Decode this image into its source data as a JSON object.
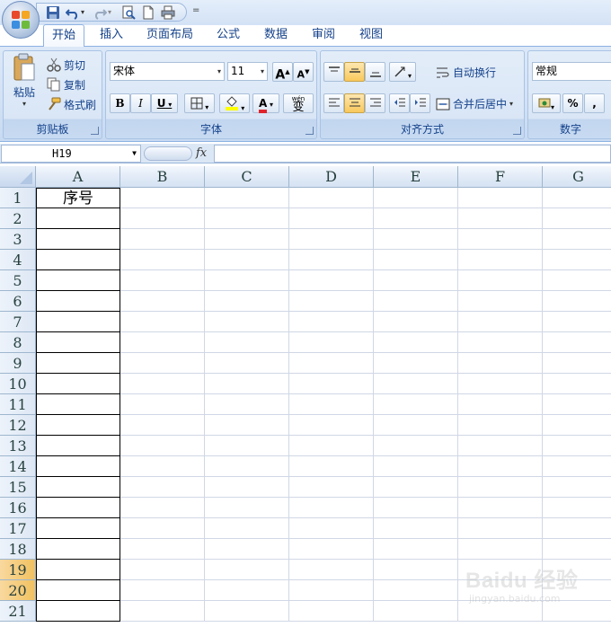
{
  "qat": {
    "icons": [
      "save-icon",
      "undo-icon",
      "redo-icon",
      "print-preview-icon",
      "new-icon",
      "print-icon"
    ],
    "more": "="
  },
  "tabs": [
    "开始",
    "插入",
    "页面布局",
    "公式",
    "数据",
    "审阅",
    "视图"
  ],
  "active_tab": "开始",
  "clipboard": {
    "paste": "粘贴",
    "cut": "剪切",
    "copy": "复制",
    "format_painter": "格式刷",
    "label": "剪贴板"
  },
  "font": {
    "name": "宋体",
    "size": "11",
    "grow": "A",
    "shrink": "A",
    "bold": "B",
    "italic": "I",
    "underline": "U",
    "font_color_glyph": "A",
    "phonetic": "wén",
    "phonetic_char": "变",
    "label": "字体"
  },
  "alignment": {
    "wrap": "自动换行",
    "merge": "合并后居中",
    "label": "对齐方式"
  },
  "number": {
    "format": "常规",
    "percent": "%",
    "comma": ",",
    "label": "数字"
  },
  "formula_bar": {
    "name_box": "H19",
    "fx": "fx",
    "value": ""
  },
  "sheet": {
    "columns": [
      "A",
      "B",
      "C",
      "D",
      "E",
      "F",
      "G"
    ],
    "rows": [
      "1",
      "2",
      "3",
      "4",
      "5",
      "6",
      "7",
      "8",
      "9",
      "10",
      "11",
      "12",
      "13",
      "14",
      "15",
      "16",
      "17",
      "18",
      "19",
      "20",
      "21"
    ],
    "selected_rows": [
      "19",
      "20"
    ],
    "cells": {
      "A1": "序号"
    }
  },
  "watermark": {
    "logo": "Baidu 经验",
    "url": "jingyan.baidu.com"
  },
  "colors": {
    "ribbon": "#d2e1f4",
    "accent": "#15428b",
    "row_highlight": "#f1c15f"
  }
}
